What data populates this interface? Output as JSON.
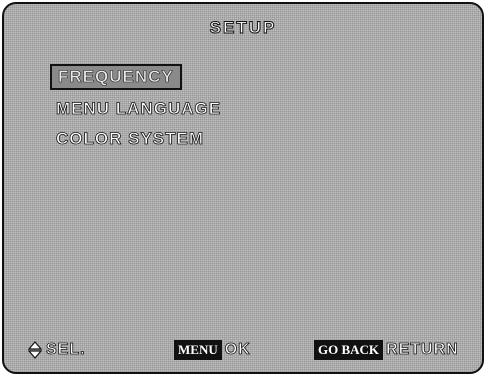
{
  "header": {
    "title": "SETUP"
  },
  "menu": {
    "items": [
      {
        "label": "FREQUENCY",
        "selected": true
      },
      {
        "label": "MENU LANGUAGE",
        "selected": false
      },
      {
        "label": "COLOR SYSTEM",
        "selected": false
      }
    ]
  },
  "footer": {
    "select_icon": "up-down-arrow-icon",
    "select_label": "SEL.",
    "menu_key": "MENU",
    "menu_label": "OK",
    "goback_key": "GO BACK",
    "goback_label": "RETURN"
  }
}
